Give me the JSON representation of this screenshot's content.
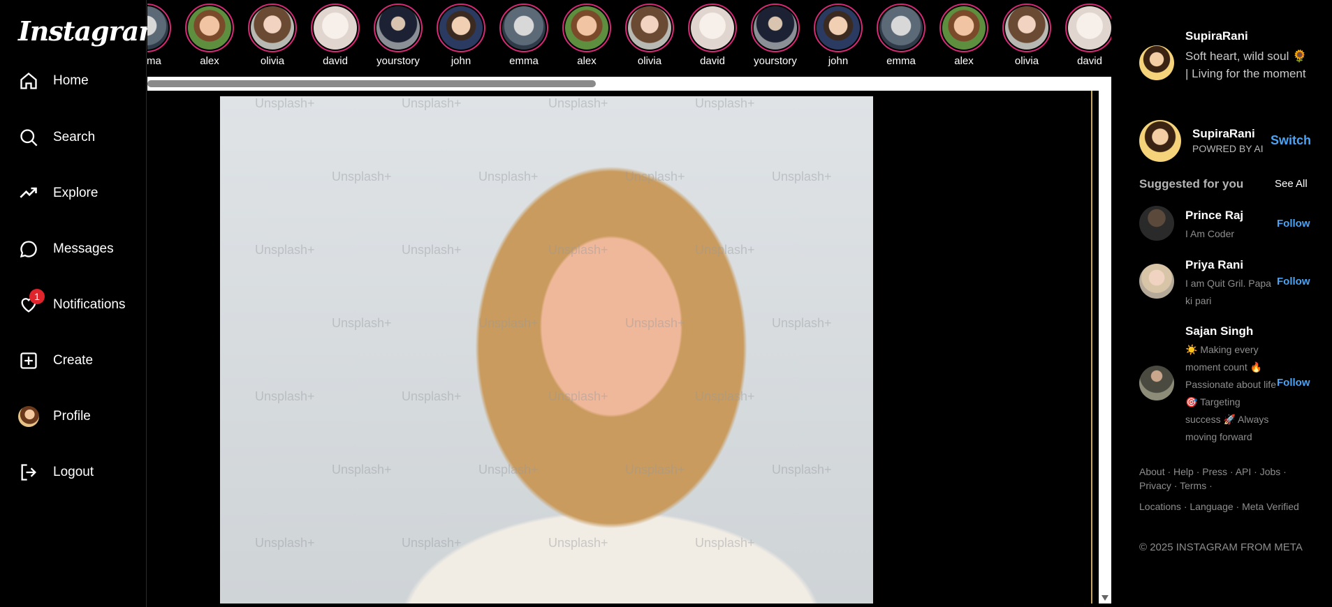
{
  "app": {
    "logo": "Instagram"
  },
  "sidebar": {
    "items": [
      {
        "label": "Home",
        "icon": "home-icon"
      },
      {
        "label": "Search",
        "icon": "search-icon"
      },
      {
        "label": "Explore",
        "icon": "trending-icon"
      },
      {
        "label": "Messages",
        "icon": "message-icon"
      },
      {
        "label": "Notifications",
        "icon": "heart-icon",
        "badge": "1"
      },
      {
        "label": "Create",
        "icon": "plus-square-icon"
      },
      {
        "label": "Profile",
        "icon": "avatar"
      },
      {
        "label": "Logout",
        "icon": "logout-icon"
      }
    ]
  },
  "stories": [
    "emma",
    "alex",
    "olivia",
    "david",
    "yourstory",
    "john",
    "emma",
    "alex",
    "olivia",
    "david",
    "yourstory",
    "john",
    "emma",
    "alex",
    "olivia",
    "david"
  ],
  "feed": {
    "watermark": "Unsplash+"
  },
  "profile": {
    "name": "SupiraRani",
    "bio": "Soft heart, wild soul 🌻 | Living for the moment"
  },
  "switch_account": {
    "name": "SupiraRani",
    "subtitle": "POWRED BY AI",
    "action": "Switch"
  },
  "suggestions": {
    "title": "Suggested for you",
    "see_all": "See All",
    "items": [
      {
        "name": "Prince Raj",
        "bio": "I Am Coder",
        "action": "Follow"
      },
      {
        "name": "Priya Rani",
        "bio": "I am Quit Gril. Papa ki pari",
        "action": "Follow"
      },
      {
        "name": "Sajan Singh",
        "bio": "☀️ Making every moment count 🔥 Passionate about life 🎯 Targeting success 🚀 Always moving forward",
        "action": "Follow"
      }
    ]
  },
  "footer": {
    "line1": "About · Help · Press · API · Jobs · Privacy · Terms ·",
    "line2": "Locations · Language · Meta Verified",
    "copyright": "© 2025 INSTAGRAM FROM META"
  },
  "colors": {
    "accent": "#4aa3f5",
    "story_ring": "#d62976",
    "badge": "#e0242b"
  }
}
